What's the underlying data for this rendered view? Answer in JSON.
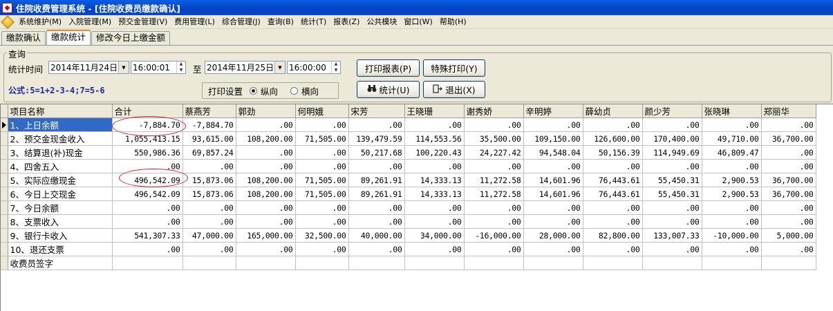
{
  "window": {
    "title": "住院收费管理系统 - [住院收费员缴款确认]"
  },
  "menu": [
    "系统维护(M)",
    "入院管理(M)",
    "预交金管理(V)",
    "费用管理(L)",
    "综合管理(J)",
    "查询(B)",
    "统计(T)",
    "报表(Z)",
    "公共模块",
    "窗口(W)",
    "帮助(H)"
  ],
  "tabs": [
    "缴款确认",
    "缴款统计",
    "修改今日上缴金额"
  ],
  "query": {
    "group_title": "查询",
    "time_label": "统计时间",
    "start_date": "2014年11月24日",
    "start_time": "16:00:01",
    "to_label": "至",
    "end_date": "2014年11月25日",
    "end_time": "16:00:00",
    "formula": "公式:5=1+2-3-4;7=5-6",
    "print_setting_label": "打印设置",
    "orientation": {
      "portrait": "纵向",
      "landscape": "横向",
      "selected": "纵向"
    }
  },
  "buttons": {
    "print_report": "打印报表(P)",
    "special_print": "特殊打印(Y)",
    "statistics": "统计(U)",
    "exit": "退出(X)"
  },
  "grid": {
    "columns": [
      "项目名称",
      "合计",
      "蔡燕芳",
      "郭劲",
      "何明娥",
      "宋芳",
      "王晓珊",
      "谢秀娇",
      "辛明婷",
      "薛幼贞",
      "颜少芳",
      "张晓琳",
      "郑丽华"
    ],
    "rows": [
      [
        "1、上日余额",
        "-7,884.70",
        "-7,884.70",
        ".00",
        ".00",
        ".00",
        ".00",
        ".00",
        ".00",
        ".00",
        ".00",
        ".00",
        ".00"
      ],
      [
        "2、预交金现金收入",
        "1,055,413.15",
        "93,615.00",
        "108,200.00",
        "71,505.00",
        "139,479.59",
        "114,553.56",
        "35,500.00",
        "109,150.00",
        "126,600.00",
        "170,400.00",
        "49,710.00",
        "36,700.00"
      ],
      [
        "3、结算退(补)现金",
        "550,986.36",
        "69,857.24",
        ".00",
        ".00",
        "50,217.68",
        "100,220.43",
        "24,227.42",
        "94,548.04",
        "50,156.39",
        "114,949.69",
        "46,809.47",
        ".00"
      ],
      [
        "4、四舍五入",
        ".00",
        ".00",
        ".00",
        ".00",
        ".00",
        ".00",
        ".00",
        ".00",
        ".00",
        ".00",
        ".00",
        ".00"
      ],
      [
        "5、实际应缴现金",
        "496,542.09",
        "15,873.06",
        "108,200.00",
        "71,505.00",
        "89,261.91",
        "14,333.13",
        "11,272.58",
        "14,601.96",
        "76,443.61",
        "55,450.31",
        "2,900.53",
        "36,700.00"
      ],
      [
        "6、今日上交现金",
        "496,542.09",
        "15,873.06",
        "108,200.00",
        "71,505.00",
        "89,261.91",
        "14,333.13",
        "11,272.58",
        "14,601.96",
        "76,443.61",
        "55,450.31",
        "2,900.53",
        "36,700.00"
      ],
      [
        "7、今日余额",
        ".00",
        ".00",
        ".00",
        ".00",
        ".00",
        ".00",
        ".00",
        ".00",
        ".00",
        ".00",
        ".00",
        ".00"
      ],
      [
        "8、支票收入",
        ".00",
        ".00",
        ".00",
        ".00",
        ".00",
        ".00",
        ".00",
        ".00",
        ".00",
        ".00",
        ".00",
        ".00"
      ],
      [
        "9、银行卡收入",
        "541,307.33",
        "47,000.00",
        "165,000.00",
        "32,500.00",
        "40,000.00",
        "34,000.00",
        "-16,000.00",
        "28,000.00",
        "82,800.00",
        "133,007.33",
        "-10,000.00",
        "5,000.00"
      ],
      [
        "10、退还支票",
        ".00",
        ".00",
        ".00",
        ".00",
        ".00",
        ".00",
        ".00",
        ".00",
        ".00",
        ".00",
        ".00",
        ".00"
      ],
      [
        "收费员签字",
        "",
        "",
        "",
        "",
        "",
        "",
        "",
        "",
        "",
        "",
        "",
        ""
      ]
    ]
  }
}
